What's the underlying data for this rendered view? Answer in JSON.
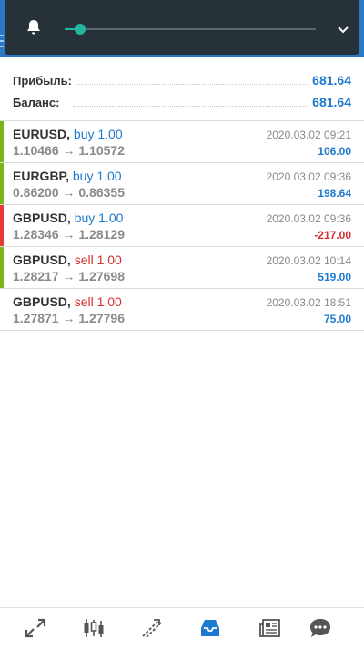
{
  "header": {
    "icons": [
      "bell-icon",
      "chevron-down-icon"
    ],
    "slider_value_fraction": 0.06
  },
  "summary": {
    "profit_label": "Прибыль:",
    "profit_value": "681.64",
    "balance_label": "Баланс:",
    "balance_value": "681.64"
  },
  "colors": {
    "accent": "#1e7ad0",
    "buy": "#1e7ad0",
    "sell": "#d32f2f",
    "win_bar": "#7cb518",
    "loss_bar": "#e53935",
    "header_bg": "#263238"
  },
  "deals": [
    {
      "symbol": "EURUSD,",
      "side": "buy 1.00",
      "type": "buy",
      "prices": "1.10466 → 1.10572",
      "time": "2020.03.02 09:21",
      "profit": "106.00",
      "result": "win"
    },
    {
      "symbol": "EURGBP,",
      "side": "buy 1.00",
      "type": "buy",
      "prices": "0.86200 → 0.86355",
      "time": "2020.03.02 09:36",
      "profit": "198.64",
      "result": "win"
    },
    {
      "symbol": "GBPUSD,",
      "side": "buy 1.00",
      "type": "buy",
      "prices": "1.28346 → 1.28129",
      "time": "2020.03.02 09:36",
      "profit": "-217.00",
      "result": "loss"
    },
    {
      "symbol": "GBPUSD,",
      "side": "sell 1.00",
      "type": "sell",
      "prices": "1.28217 → 1.27698",
      "time": "2020.03.02 10:14",
      "profit": "519.00",
      "result": "win"
    },
    {
      "symbol": "GBPUSD,",
      "side": "sell 1.00",
      "type": "sell",
      "prices": "1.27871 → 1.27796",
      "time": "2020.03.02 18:51",
      "profit": "75.00",
      "result": "none"
    }
  ],
  "tabs": [
    {
      "icon": "quotes-icon",
      "active": false
    },
    {
      "icon": "chart-icon",
      "active": false
    },
    {
      "icon": "trade-icon",
      "active": false
    },
    {
      "icon": "history-icon",
      "active": true
    },
    {
      "icon": "news-icon",
      "active": false
    },
    {
      "icon": "chat-icon",
      "active": false
    }
  ]
}
